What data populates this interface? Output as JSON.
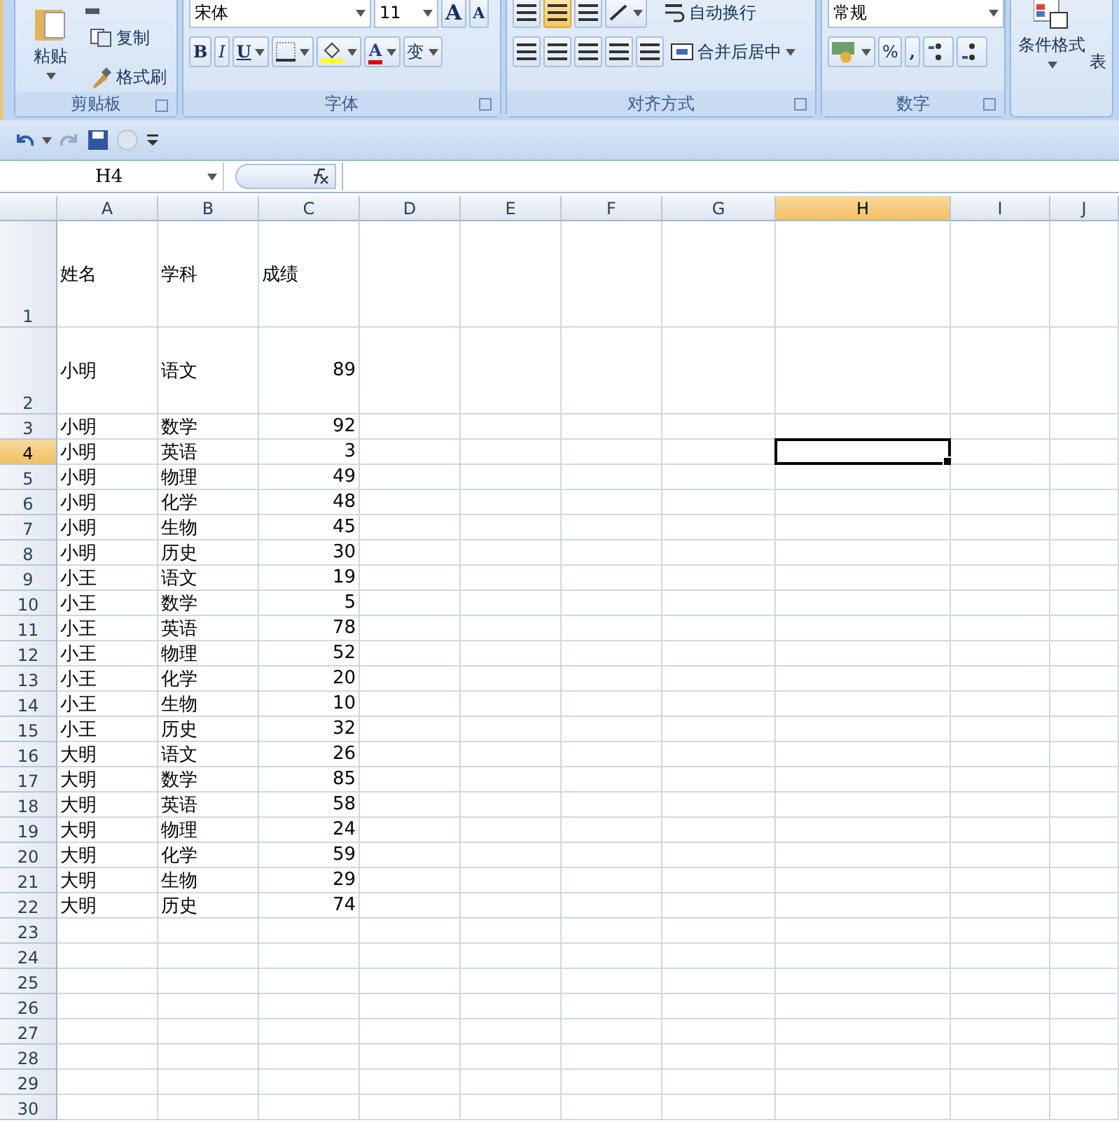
{
  "ribbon": {
    "groups": [
      {
        "kind": "clipboard",
        "label": "剪贴板",
        "paste": "粘贴",
        "copy": "复制",
        "format_painter": "格式刷"
      },
      {
        "kind": "font",
        "label": "字体",
        "font_name": "宋体",
        "font_size": "11",
        "grow": "A",
        "shrink": "A",
        "bold": "B",
        "italic": "I",
        "underline": "U",
        "font_color": "A",
        "phonetic": "变"
      },
      {
        "kind": "alignment",
        "label": "对齐方式",
        "wrap": "自动换行",
        "merge": "合并后居中"
      },
      {
        "kind": "number",
        "label": "数字",
        "format": "常规",
        "percent": "%",
        "comma": ","
      },
      {
        "kind": "styles",
        "conditional": "条件格式",
        "table": "表"
      }
    ]
  },
  "name_box": "H4",
  "sheet": {
    "columns": [
      {
        "label": "A",
        "kind": "text",
        "selected": false
      },
      {
        "label": "B",
        "kind": "text",
        "selected": false
      },
      {
        "label": "C",
        "kind": "numeric",
        "selected": false
      },
      {
        "label": "D",
        "kind": "text",
        "selected": false
      },
      {
        "label": "E",
        "kind": "text",
        "selected": false
      },
      {
        "label": "F",
        "kind": "text",
        "selected": false
      },
      {
        "label": "G",
        "kind": "text",
        "selected": false
      },
      {
        "label": "H",
        "kind": "text",
        "selected": true
      },
      {
        "label": "I",
        "kind": "text",
        "selected": false
      },
      {
        "label": "J",
        "kind": "text",
        "selected": false
      }
    ],
    "rows": [
      {
        "number": "1",
        "kind": "tall",
        "selected": false,
        "cells": [
          "姓名",
          "学科",
          "成绩"
        ]
      },
      {
        "number": "2",
        "kind": "medium",
        "selected": false,
        "cells": [
          "小明",
          "语文",
          "89"
        ]
      },
      {
        "number": "3",
        "kind": "normal",
        "selected": false,
        "cells": [
          "小明",
          "数学",
          "92"
        ]
      },
      {
        "number": "4",
        "kind": "normal",
        "selected": true,
        "cells": [
          "小明",
          "英语",
          "3"
        ]
      },
      {
        "number": "5",
        "kind": "normal",
        "selected": false,
        "cells": [
          "小明",
          "物理",
          "49"
        ]
      },
      {
        "number": "6",
        "kind": "normal",
        "selected": false,
        "cells": [
          "小明",
          "化学",
          "48"
        ]
      },
      {
        "number": "7",
        "kind": "normal",
        "selected": false,
        "cells": [
          "小明",
          "生物",
          "45"
        ]
      },
      {
        "number": "8",
        "kind": "normal",
        "selected": false,
        "cells": [
          "小明",
          "历史",
          "30"
        ]
      },
      {
        "number": "9",
        "kind": "normal",
        "selected": false,
        "cells": [
          "小王",
          "语文",
          "19"
        ]
      },
      {
        "number": "10",
        "kind": "normal",
        "selected": false,
        "cells": [
          "小王",
          "数学",
          "5"
        ]
      },
      {
        "number": "11",
        "kind": "normal",
        "selected": false,
        "cells": [
          "小王",
          "英语",
          "78"
        ]
      },
      {
        "number": "12",
        "kind": "normal",
        "selected": false,
        "cells": [
          "小王",
          "物理",
          "52"
        ]
      },
      {
        "number": "13",
        "kind": "normal",
        "selected": false,
        "cells": [
          "小王",
          "化学",
          "20"
        ]
      },
      {
        "number": "14",
        "kind": "normal",
        "selected": false,
        "cells": [
          "小王",
          "生物",
          "10"
        ]
      },
      {
        "number": "15",
        "kind": "normal",
        "selected": false,
        "cells": [
          "小王",
          "历史",
          "32"
        ]
      },
      {
        "number": "16",
        "kind": "normal",
        "selected": false,
        "cells": [
          "大明",
          "语文",
          "26"
        ]
      },
      {
        "number": "17",
        "kind": "normal",
        "selected": false,
        "cells": [
          "大明",
          "数学",
          "85"
        ]
      },
      {
        "number": "18",
        "kind": "normal",
        "selected": false,
        "cells": [
          "大明",
          "英语",
          "58"
        ]
      },
      {
        "number": "19",
        "kind": "normal",
        "selected": false,
        "cells": [
          "大明",
          "物理",
          "24"
        ]
      },
      {
        "number": "20",
        "kind": "normal",
        "selected": false,
        "cells": [
          "大明",
          "化学",
          "59"
        ]
      },
      {
        "number": "21",
        "kind": "normal",
        "selected": false,
        "cells": [
          "大明",
          "生物",
          "29"
        ]
      },
      {
        "number": "22",
        "kind": "normal",
        "selected": false,
        "cells": [
          "大明",
          "历史",
          "74"
        ]
      },
      {
        "number": "23",
        "kind": "normal",
        "selected": false,
        "cells": []
      },
      {
        "number": "24",
        "kind": "normal",
        "selected": false,
        "cells": []
      },
      {
        "number": "25",
        "kind": "normal",
        "selected": false,
        "cells": []
      },
      {
        "number": "26",
        "kind": "normal",
        "selected": false,
        "cells": []
      },
      {
        "number": "27",
        "kind": "normal",
        "selected": false,
        "cells": []
      },
      {
        "number": "28",
        "kind": "normal",
        "selected": false,
        "cells": []
      },
      {
        "number": "29",
        "kind": "normal",
        "selected": false,
        "cells": []
      },
      {
        "number": "30",
        "kind": "normal",
        "selected": false,
        "cells": []
      }
    ]
  }
}
